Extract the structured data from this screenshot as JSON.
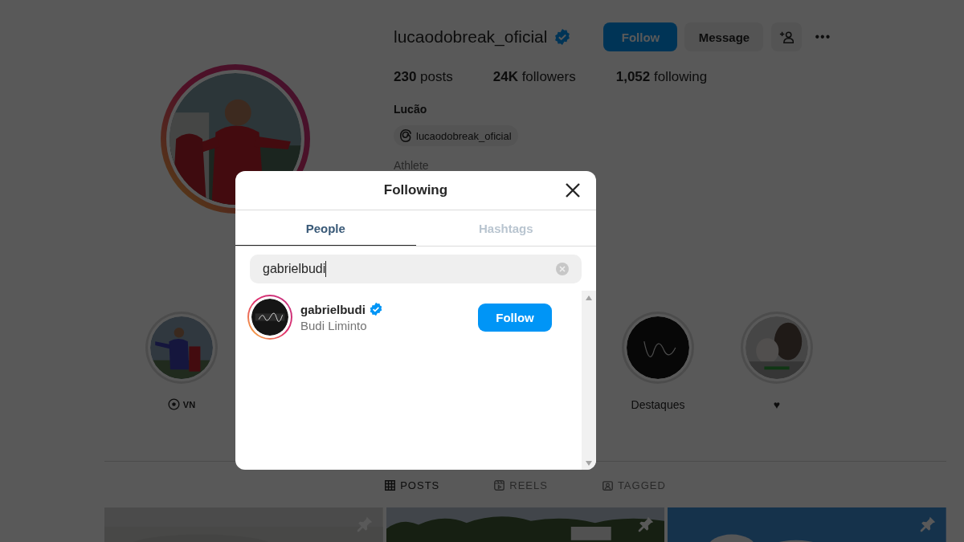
{
  "profile": {
    "username": "lucaodobreak_oficial",
    "verified": true,
    "follow_button": "Follow",
    "message_button": "Message",
    "more_button": "•••",
    "stats": [
      {
        "count": "230",
        "label": "posts"
      },
      {
        "count": "24K",
        "label": "followers"
      },
      {
        "count": "1,052",
        "label": "following"
      }
    ],
    "name": "Lucão",
    "threads_handle": "lucaodobreak_oficial",
    "category": "Athlete"
  },
  "highlights": [
    {
      "label": "VN",
      "kind": "ball"
    },
    {
      "label": "Destaques",
      "kind": "plain"
    },
    {
      "label": "♥",
      "kind": "plain"
    }
  ],
  "profile_tabs": [
    {
      "label": "POSTS",
      "selected": true,
      "kind": "grid"
    },
    {
      "label": "REELS",
      "selected": false,
      "kind": "reels"
    },
    {
      "label": "TAGGED",
      "selected": false,
      "kind": "tagged"
    }
  ],
  "posts": [
    {
      "pinned": true
    },
    {
      "pinned": true
    },
    {
      "pinned": true
    }
  ],
  "dialog": {
    "title": "Following",
    "tabs": [
      {
        "label": "People",
        "selected": true
      },
      {
        "label": "Hashtags",
        "selected": false
      }
    ],
    "search": {
      "value": "gabrielbudi"
    },
    "results": [
      {
        "username": "gabrielbudi",
        "verified": true,
        "full_name": "Budi Liminto",
        "button": "Follow"
      }
    ]
  }
}
